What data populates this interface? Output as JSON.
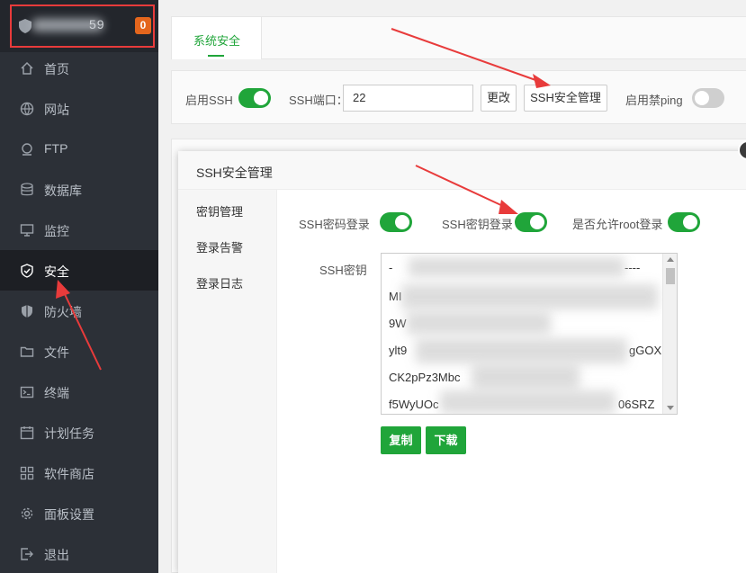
{
  "brand": {
    "name_suffix": "59",
    "badge": "0"
  },
  "sidebar": {
    "items": [
      {
        "label": "首页",
        "icon": "home-icon"
      },
      {
        "label": "网站",
        "icon": "globe-icon"
      },
      {
        "label": "FTP",
        "icon": "ftp-icon"
      },
      {
        "label": "数据库",
        "icon": "database-icon"
      },
      {
        "label": "监控",
        "icon": "monitor-icon"
      },
      {
        "label": "安全",
        "icon": "shield-check-icon",
        "active": true
      },
      {
        "label": "防火墙",
        "icon": "firewall-icon"
      },
      {
        "label": "文件",
        "icon": "folder-icon"
      },
      {
        "label": "终端",
        "icon": "terminal-icon"
      },
      {
        "label": "计划任务",
        "icon": "calendar-icon"
      },
      {
        "label": "软件商店",
        "icon": "apps-icon"
      },
      {
        "label": "面板设置",
        "icon": "gear-icon"
      },
      {
        "label": "退出",
        "icon": "logout-icon"
      }
    ]
  },
  "tabs": {
    "active": "系统安全"
  },
  "settings": {
    "enable_ssh_label": "启用SSH",
    "enable_ssh": true,
    "port_label": "SSH端口：",
    "port_value": "22",
    "change_button": "更改",
    "ssh_manage_button": "SSH安全管理",
    "disable_ping_label": "启用禁ping",
    "disable_ping": false
  },
  "modal": {
    "title": "SSH安全管理",
    "side_items": [
      "密钥管理",
      "登录告警",
      "登录日志"
    ],
    "password_login_label": "SSH密码登录",
    "password_login": true,
    "key_login_label": "SSH密钥登录",
    "key_login": true,
    "root_login_label": "是否允许root登录",
    "root_login": true,
    "key_label": "SSH密钥",
    "key_lines": [
      "-",
      "MI",
      "9W",
      "ylt9",
      "CK2pPz3Mbc",
      "f5WyUOc"
    ],
    "key_tail_fragments": [
      "----",
      "gGOX",
      "06SRZ"
    ],
    "copy_button": "复制",
    "download_button": "下载"
  },
  "colors": {
    "accent": "#20a53a",
    "sidebar_bg": "#2c3037",
    "badge": "#e4661d",
    "annotation": "#e83b3b"
  }
}
